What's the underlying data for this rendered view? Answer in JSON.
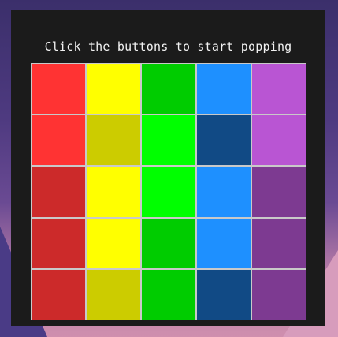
{
  "game": {
    "title": "Click the buttons to start popping"
  },
  "colors": {
    "panel_bg": "#1b1b1b",
    "grid_border": "#c9c9c9"
  },
  "board": {
    "rows": [
      [
        "#ff3333",
        "#ffff00",
        "#00cc00",
        "#1e90ff",
        "#b955d3"
      ],
      [
        "#ff3333",
        "#cccc00",
        "#00ff00",
        "#114a85",
        "#b955d3"
      ],
      [
        "#cc2a2a",
        "#ffff00",
        "#00ff00",
        "#1e90ff",
        "#7d3a91"
      ],
      [
        "#cc2a2a",
        "#ffff00",
        "#00cc00",
        "#1e90ff",
        "#7d3a91"
      ],
      [
        "#cc2a2a",
        "#cccc00",
        "#00cc00",
        "#114a85",
        "#7d3a91"
      ]
    ]
  }
}
